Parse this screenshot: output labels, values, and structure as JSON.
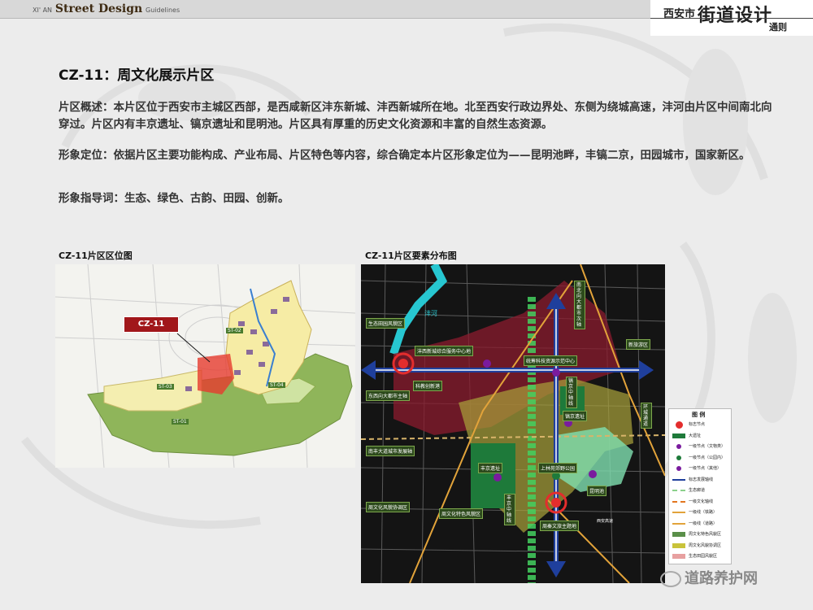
{
  "header": {
    "brand_prefix": "XI' AN",
    "brand_main": "Street Design",
    "brand_sub": "Guidelines",
    "city": "西安市",
    "title": "街道设计",
    "subtitle": "通则"
  },
  "section": {
    "heading": "CZ-11：周文化展示片区",
    "overview": "片区概述：本片区位于西安市主城区西部，是西咸新区沣东新城、沣西新城所在地。北至西安行政边界处、东侧为绕城高速，沣河由片区中间南北向穿过。片区内有丰京遗址、镐京遗址和昆明池。片区具有厚重的历史文化资源和丰富的自然生态资源。",
    "positioning": "形象定位：依据片区主要功能构成、产业布局、片区特色等内容，综合确定本片区形象定位为——昆明池畔，丰镐二京，田园城市，国家新区。",
    "keywords": "形象指导词：生态、绿色、古韵、田园、创新。"
  },
  "map_location": {
    "caption": "CZ-11片区区位图",
    "callout": "CZ-11",
    "zones": [
      "ST-02",
      "ST-03",
      "ST-04",
      "ST-01"
    ]
  },
  "map_elements": {
    "caption": "CZ-11片区要素分布图",
    "labels": {
      "eco": "生态田园风貌区",
      "fengxi": "沣西新城综合服务中心地",
      "kechuang": "科教创新港",
      "dongxi": "东西向大都市主轴",
      "tongjian": "统筹科技资源示范中心",
      "nanbei": "南北向大都市次轴",
      "haojing_axis": "镐京中轴线",
      "haojing": "镐京遗址",
      "nanfeng": "南丰大道城市发展轴",
      "fengjing": "丰京遗址",
      "shanglin": "上林苑郊野公园",
      "kunming": "昆明池",
      "fengjing_axis": "丰京中轴线",
      "zhoufeng": "周文化风貌协调区",
      "tese": "周文化特色风貌区",
      "zhouqin": "周秦文旅主题地",
      "river": "沣河",
      "right": "环城通道",
      "bottom": "西安高速",
      "top_right": "新旅游区"
    }
  },
  "legend": {
    "title": "图 例",
    "items": [
      "标志节点",
      "大遗址",
      "一级节点（文物类）",
      "一级节点（公园内）",
      "一级节点（其他）",
      "标志发展轴线",
      "生态廊道",
      "一级文化轴线",
      "一级线（铁路）",
      "一级线（道路）",
      "周文化特色风貌区",
      "周文化风貌协调区",
      "生态田园风貌区"
    ]
  },
  "watermark": "道路养护网",
  "colors": {
    "accent_red": "#e32d2d",
    "axis_blue": "#1f3f9c",
    "green_zone": "#1e7a3a",
    "yellow_zone": "#c9c33b"
  }
}
